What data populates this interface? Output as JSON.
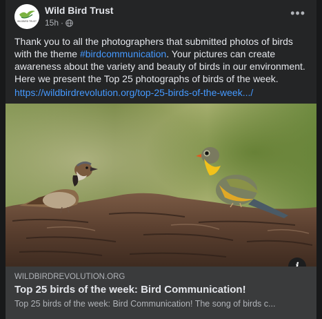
{
  "post": {
    "page_name": "Wild Bird Trust",
    "timestamp": "15h",
    "audience_icon": "globe-icon",
    "more_icon": "more-options-icon",
    "avatar_logo_text": "WILDBIRD TRUST",
    "text_before_hashtag": "Thank you to all the photographers that submitted photos of birds with the theme ",
    "hashtag": "#birdcommunication",
    "text_after_hashtag": ". Your pictures can create awareness about the variety and beauty of birds in our environment. Here we present the Top 25 photographs of birds of the week.",
    "link_url": "https://wildbirdrevolution.org/top-25-birds-of-the-week.../"
  },
  "link_preview": {
    "domain": "WILDBIRDREVOLUTION.ORG",
    "title": "Top 25 birds of the week: Bird Communication!",
    "description": "Top 25 birds of the week: Bird Communication! The song of birds c...",
    "info_icon": "info-icon",
    "info_label": "i"
  },
  "colors": {
    "background": "#18191a",
    "card": "#242526",
    "preview_bg": "#3a3b3c",
    "primary_text": "#e4e6eb",
    "secondary_text": "#b0b3b8",
    "link": "#4599ff"
  }
}
